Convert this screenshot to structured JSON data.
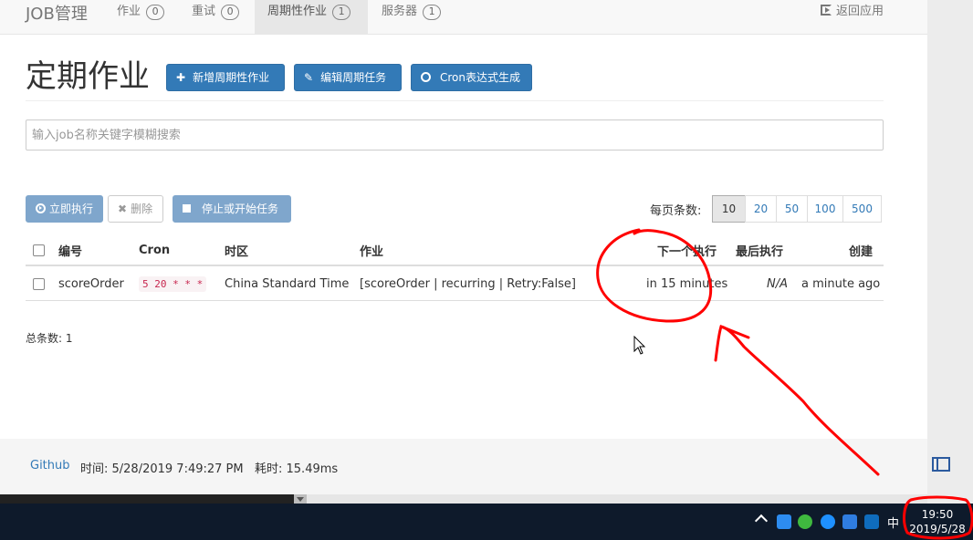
{
  "navbar": {
    "brand": "JOB管理",
    "items": [
      {
        "label": "作业",
        "count": "0"
      },
      {
        "label": "重试",
        "count": "0"
      },
      {
        "label": "周期性作业",
        "count": "1"
      },
      {
        "label": "服务器",
        "count": "1"
      }
    ],
    "back_label": "返回应用"
  },
  "header": {
    "title": "定期作业",
    "buttons": {
      "add": "新增周期性作业",
      "edit": "编辑周期任务",
      "cron": "Cron表达式生成"
    }
  },
  "search": {
    "placeholder": "输入job名称关键字模糊搜索"
  },
  "toolbar": {
    "run_now": "立即执行",
    "delete": "删除",
    "stop_start": "停止或开始任务"
  },
  "pager": {
    "label": "每页条数:",
    "options": [
      "10",
      "20",
      "50",
      "100",
      "500"
    ],
    "selected": "10"
  },
  "table": {
    "headers": [
      "编号",
      "Cron",
      "时区",
      "作业",
      "下一个执行",
      "最后执行",
      "创建"
    ],
    "rows": [
      {
        "id": "scoreOrder",
        "cron": "5 20 * * *",
        "timezone": "China Standard Time",
        "job": "[scoreOrder | recurring | Retry:False]",
        "next": "in 15 minutes",
        "last": "N/A",
        "created": "a minute ago"
      }
    ]
  },
  "total": "总条数: 1",
  "footer": {
    "github": "Github",
    "info": "时间: 5/28/2019 7:49:27 PM   耗时: 15.49ms"
  },
  "taskbar": {
    "ime": "中",
    "time": "19:50",
    "date": "2019/5/28"
  },
  "colors": {
    "primary": "#337ab7",
    "annotation": "#ff0000",
    "taskbar": "#0e1a2b"
  }
}
